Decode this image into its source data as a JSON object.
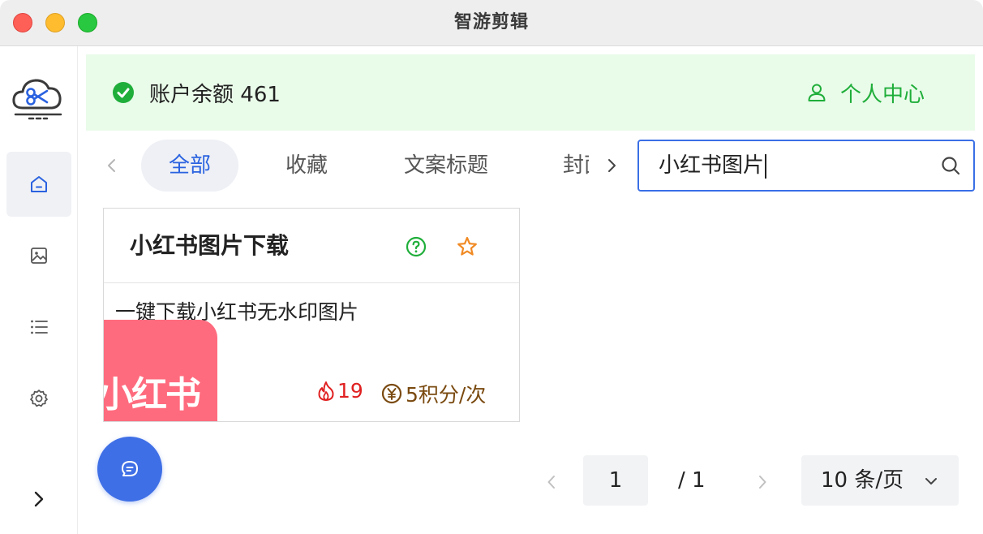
{
  "window": {
    "title": "智游剪辑"
  },
  "banner": {
    "balance_label": "账户余额",
    "balance_value": "461",
    "profile_label": "个人中心"
  },
  "sidebar": {
    "items": [
      {
        "icon": "home-icon",
        "active": true
      },
      {
        "icon": "image-icon",
        "active": false
      },
      {
        "icon": "list-icon",
        "active": false
      },
      {
        "icon": "gear-icon",
        "active": false
      }
    ],
    "expand_icon": "chevron-right-icon"
  },
  "tabs": [
    {
      "label": "全部",
      "active": true
    },
    {
      "label": "收藏",
      "active": false
    },
    {
      "label": "文案标题",
      "active": false
    },
    {
      "label": "封面",
      "active": false
    }
  ],
  "search": {
    "value": "小红书图片"
  },
  "cards": [
    {
      "title": "小红书图片下载",
      "description": "一键下载小红书无水印图片",
      "thumbnail_text": "小红书",
      "hot_count": "19",
      "price": "5积分/次"
    }
  ],
  "pagination": {
    "current_page": "1",
    "total_pages": "/  1",
    "page_size": "10 条/页"
  },
  "colors": {
    "accent": "#3f6fe6",
    "success": "#1fae3a",
    "banner_bg": "#e9fbe9",
    "hot": "#e02020",
    "price": "#7a4a10",
    "star": "#f08a24",
    "thumbnail_bg": "#ff6b7e"
  }
}
